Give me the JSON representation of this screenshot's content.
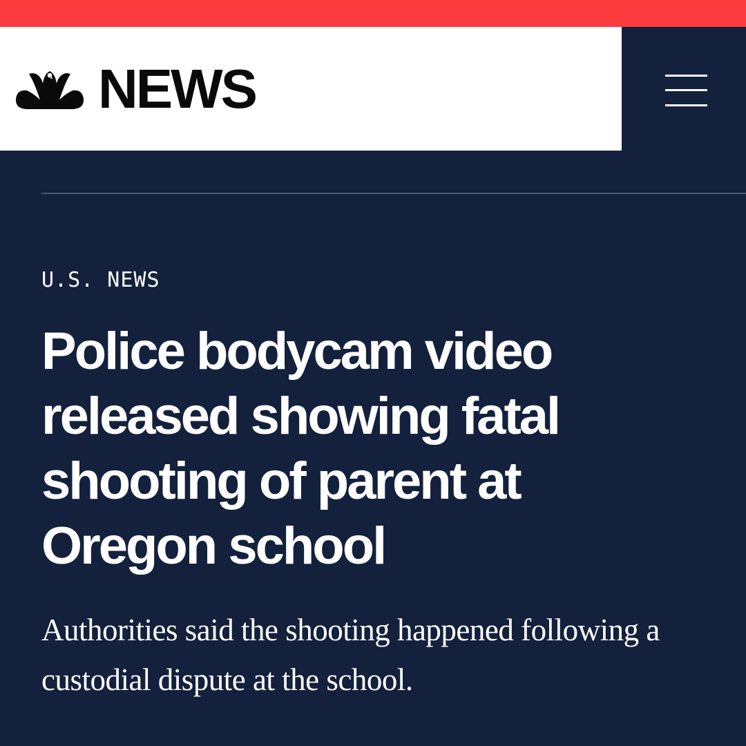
{
  "brand": {
    "logo_text": "NEWS",
    "logo_icon": "nbc-peacock-icon",
    "colors": {
      "accent_red": "#fb3b3e",
      "navy": "#13213c",
      "white": "#ffffff"
    }
  },
  "header": {
    "menu_icon": "hamburger-menu-icon"
  },
  "article": {
    "section": "U.S. NEWS",
    "headline": "Police bodycam video released showing fatal shooting of parent at Oregon school",
    "dek": "Authorities said the shooting happened following a custodial dispute at the school."
  }
}
